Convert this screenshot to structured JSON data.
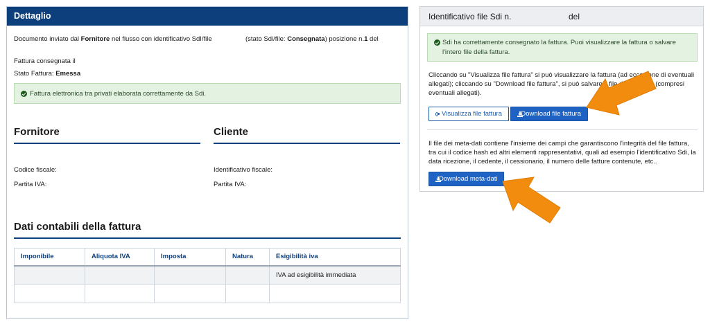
{
  "dettaglio": {
    "header": "Dettaglio",
    "doc_prefix": "Documento inviato dal",
    "doc_fornitore": "Fornitore",
    "doc_suffix": "nel flusso con identificativo SdI/file",
    "stato_prefix": "(stato Sdi/file:",
    "stato_value": "Consegnata",
    "stato_suffix": ") posizione n.",
    "posizione": "1",
    "del": "del",
    "consegnata": "Fattura consegnata il",
    "stato_fattura_label": "Stato Fattura:",
    "stato_fattura_value": "Emessa",
    "alert": "Fattura elettronica tra privati elaborata correttamente da Sdi."
  },
  "fornitore": {
    "title": "Fornitore",
    "codice_fiscale": "Codice fiscale:",
    "partita_iva": "Partita IVA:"
  },
  "cliente": {
    "title": "Cliente",
    "identificativo_fiscale": "Identificativo fiscale:",
    "partita_iva": "Partita IVA:"
  },
  "dati_contabili": {
    "title": "Dati contabili della fattura",
    "columns": [
      "Imponibile",
      "Aliquota IVA",
      "Imposta",
      "Natura",
      "Esigibilità iva"
    ],
    "rows": [
      [
        "",
        "",
        "",
        "",
        "IVA ad esigibilità immediata"
      ],
      [
        "",
        "",
        "",
        "",
        ""
      ]
    ]
  },
  "sdi_panel": {
    "header_prefix": "Identificativo file Sdi n.",
    "header_del": "del",
    "alert": "Sdi ha correttamente consegnato la fattura. Puoi visualizzare la fattura o salvare l'intero file della fattura.",
    "para1": "Cliccando su \"Visualizza file fattura\" si può visualizzare la fattura (ad eccezione di eventuali allegati); cliccando su \"Download file fattura\", si può salvare il file della fattura (compresi eventuali allegati).",
    "btn_visualizza": "Visualizza file fattura",
    "btn_download": "Download file fattura",
    "para2": "Il file dei meta-dati contiene l'insieme dei campi che garantiscono l'integrità del file fattura, tra cui il codice hash ed altri elementi rappresentativi, quali ad esempio l'identificativo Sdi, la data ricezione, il cedente, il cessionario, il numero delle fatture contenute, etc..",
    "btn_meta": "Download meta-dati"
  },
  "colors": {
    "primary": "#0e3f7d",
    "button": "#1e63c4",
    "success_bg": "#e4f2e1",
    "arrow": "#f28c0f"
  },
  "icons": [
    "check-circle-icon",
    "eye-icon",
    "download-icon",
    "arrow-pointer-icon"
  ]
}
